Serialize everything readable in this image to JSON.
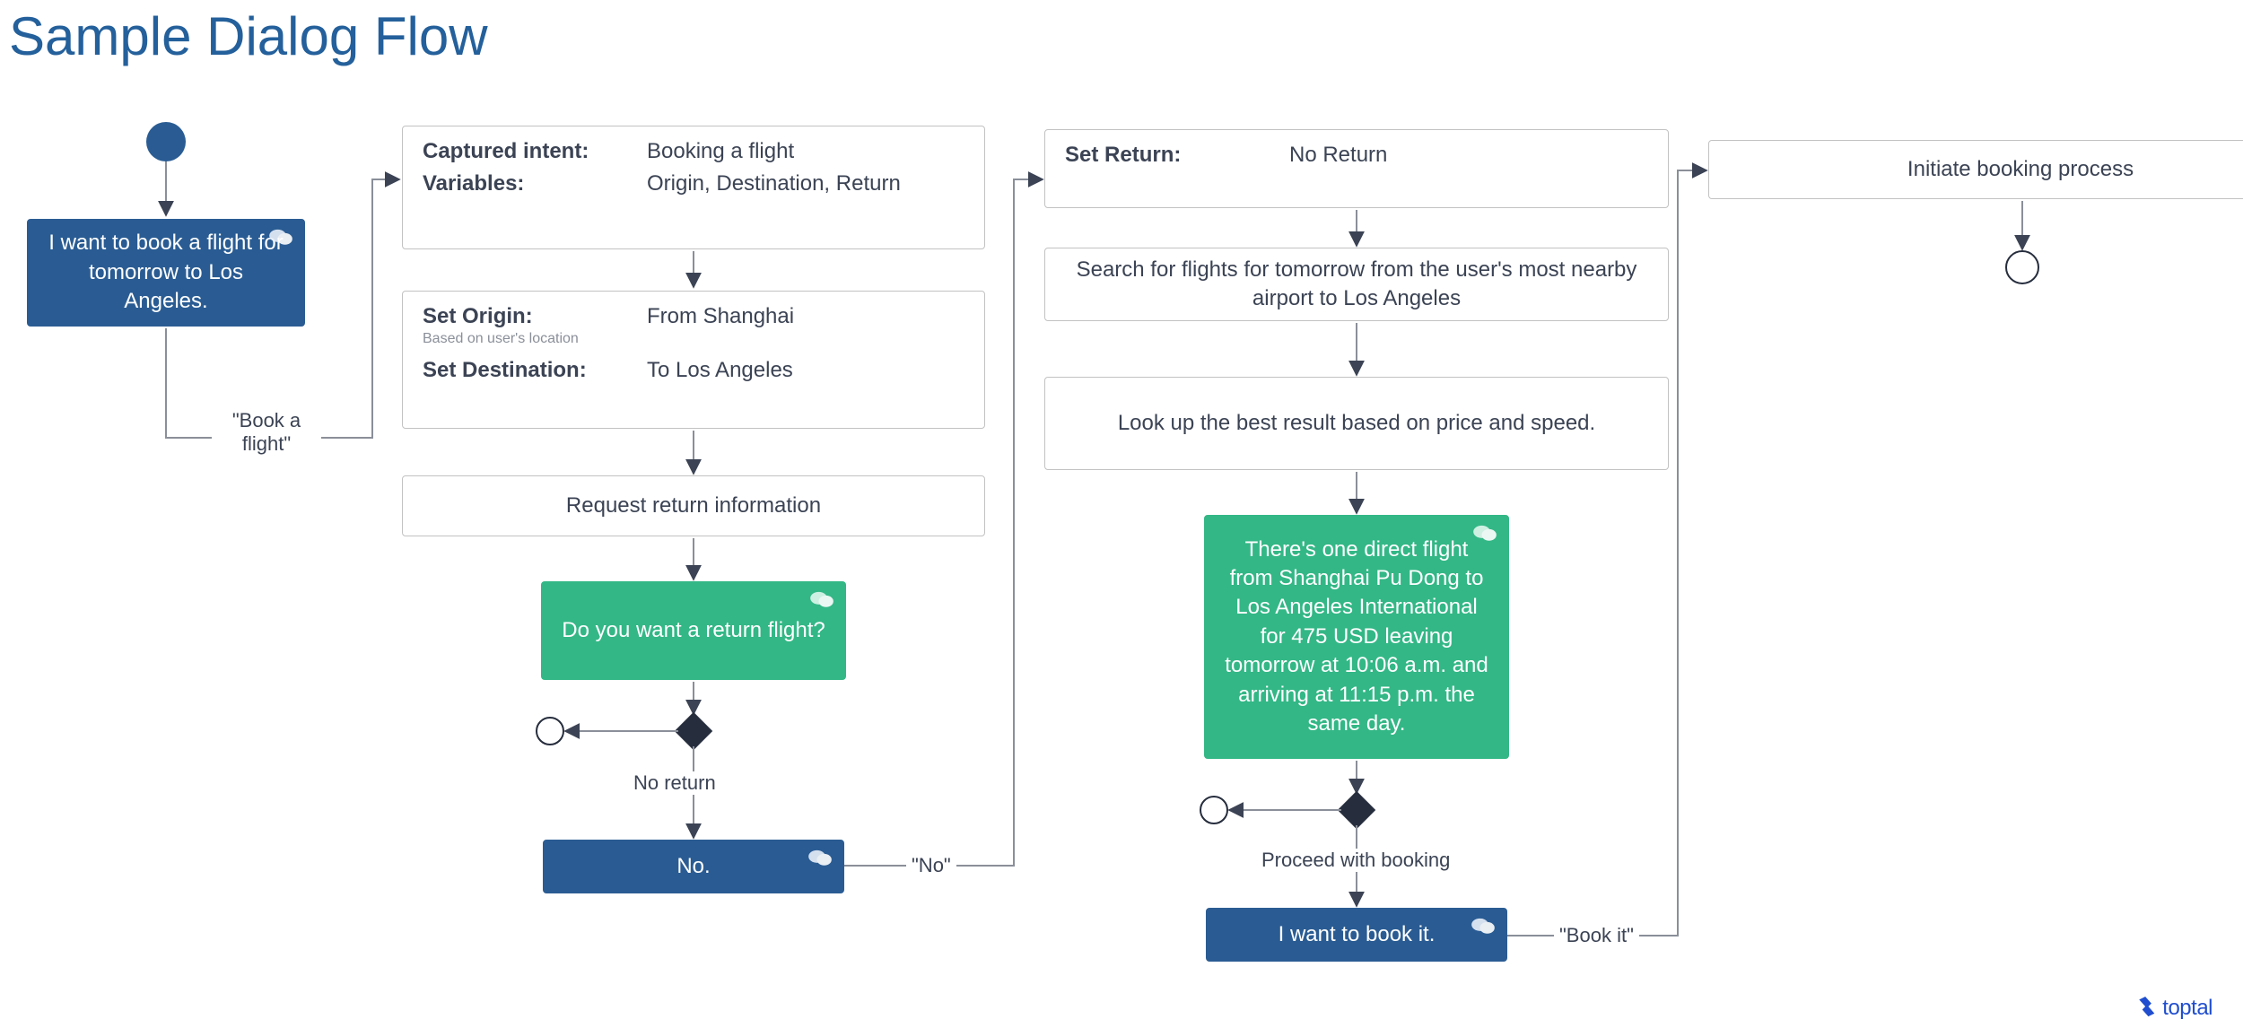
{
  "title": "Sample Dialog Flow",
  "user_utterance_1": "I want to book a flight for tomorrow to Los Angeles.",
  "intent_box": {
    "captured_intent_label": "Captured intent:",
    "captured_intent_value": "Booking a flight",
    "variables_label": "Variables:",
    "variables_value": "Origin, Destination, Return"
  },
  "origin_box": {
    "set_origin_label": "Set Origin:",
    "set_origin_sub": "Based on user's location",
    "set_origin_value": "From Shanghai",
    "set_destination_label": "Set Destination:",
    "set_destination_value": "To Los Angeles"
  },
  "request_return": "Request return information",
  "bot_return_q": "Do you want a return flight?",
  "decision1_label": "No return",
  "user_utterance_2": "No.",
  "set_return_box": {
    "set_return_label": "Set Return:",
    "set_return_value": "No Return"
  },
  "search_flights": "Search for flights for tomorrow from the user's most nearby airport to Los Angeles",
  "lookup_best": "Look up the best result based on price and speed.",
  "bot_result": "There's one direct flight from Shanghai Pu Dong to Los Angeles International for 475 USD leaving tomorrow at 10:06 a.m. and arriving at 11:15 p.m. the same day.",
  "decision2_label": "Proceed with booking",
  "user_utterance_3": "I want to book it.",
  "initiate_booking": "Initiate booking process",
  "edge_labels": {
    "book_a_flight": "\"Book a flight\"",
    "no": "\"No\"",
    "book_it": "\"Book it\""
  },
  "footer": "toptal"
}
